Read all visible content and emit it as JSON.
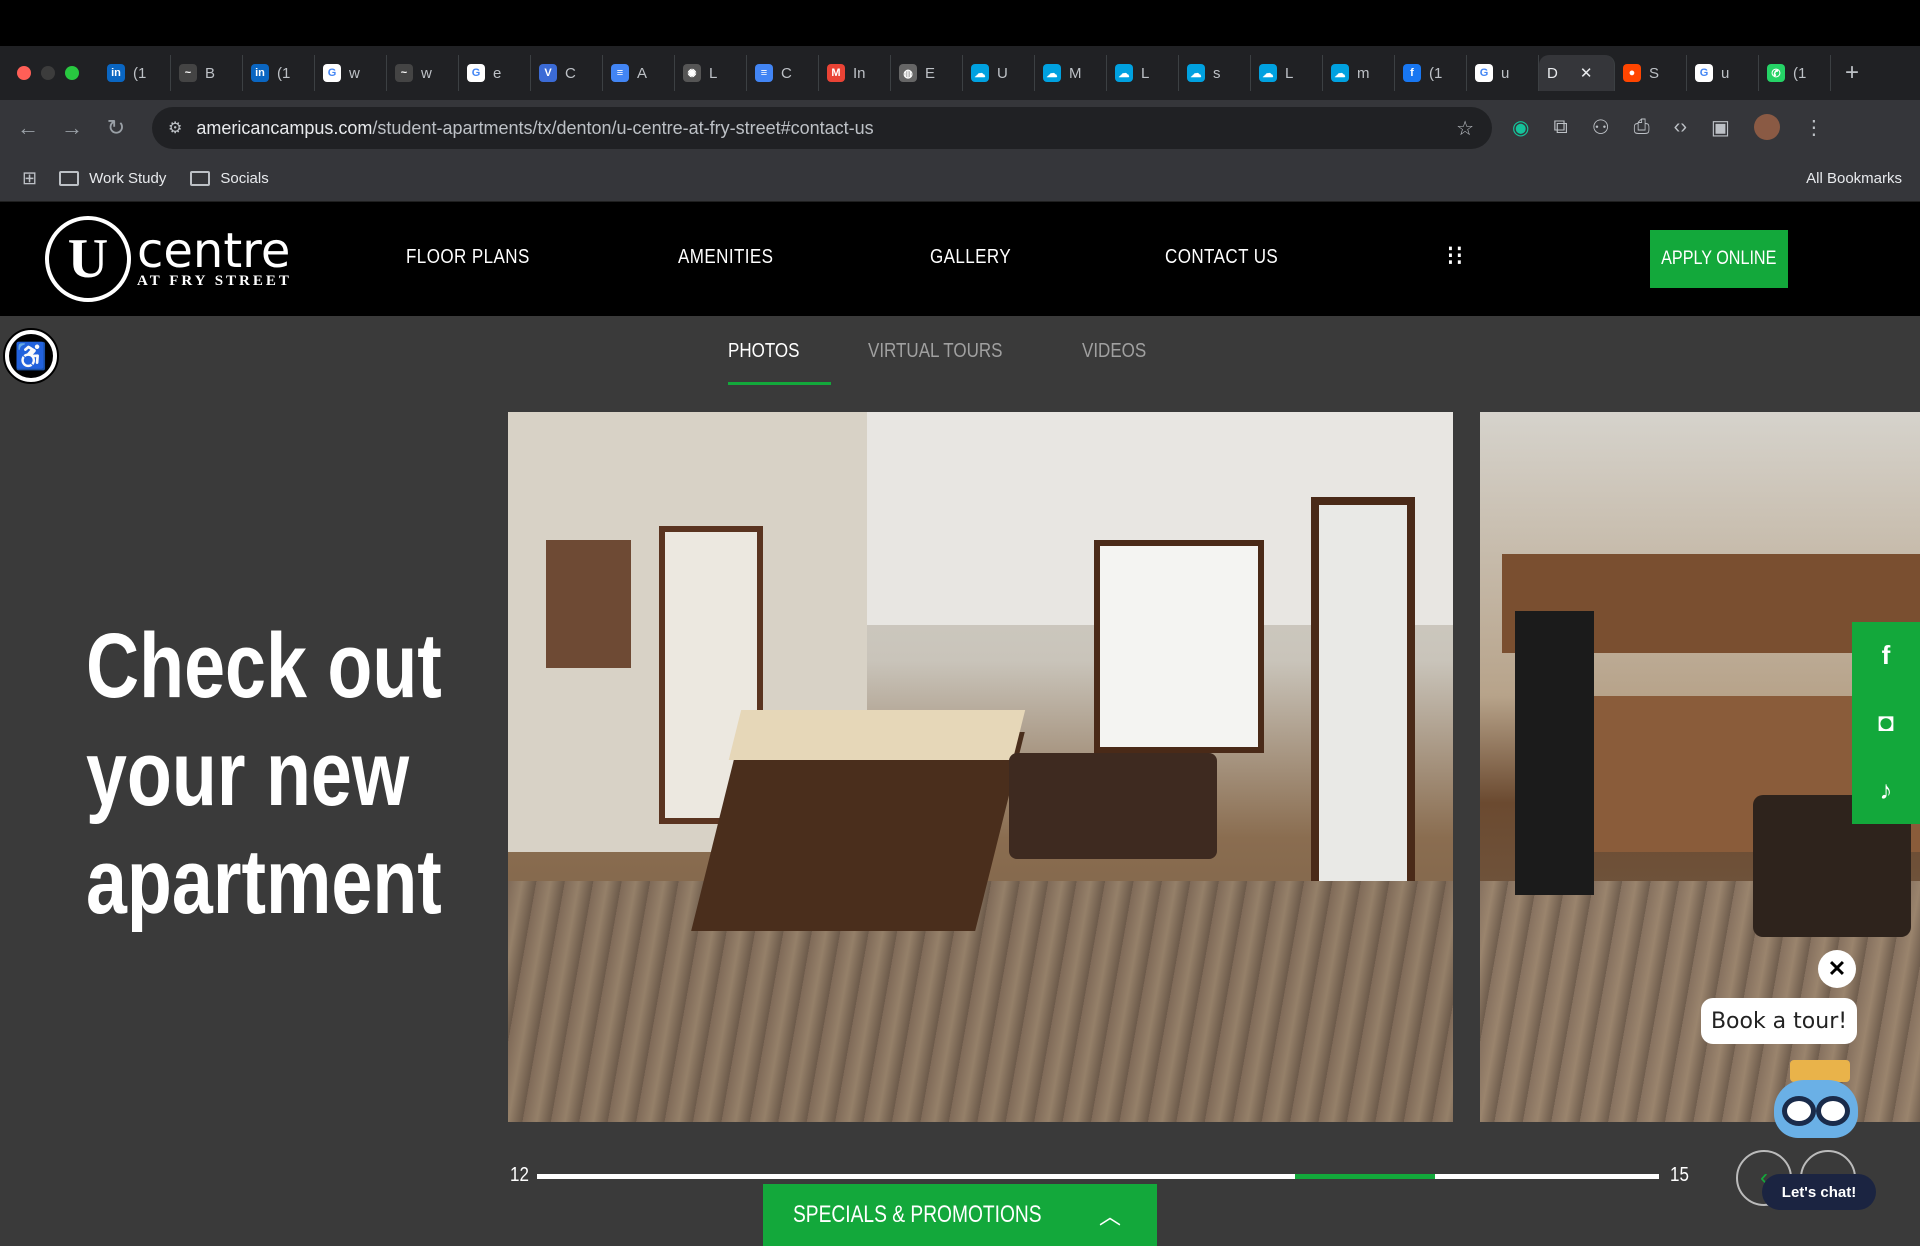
{
  "browser": {
    "tabs": [
      {
        "label": "(1",
        "icon": "linkedin-icon",
        "color": "#0a66c2",
        "glyph": "in"
      },
      {
        "label": "B",
        "icon": "blackboard-icon",
        "color": "#444",
        "glyph": "~"
      },
      {
        "label": "(1",
        "icon": "linkedin-icon",
        "color": "#0a66c2",
        "glyph": "in"
      },
      {
        "label": "w",
        "icon": "google-icon",
        "color": "#fff",
        "glyph": "G"
      },
      {
        "label": "w",
        "icon": "blackboard-icon",
        "color": "#444",
        "glyph": "~"
      },
      {
        "label": "e",
        "icon": "google-icon",
        "color": "#fff",
        "glyph": "G"
      },
      {
        "label": "C",
        "icon": "vercel-icon",
        "color": "#3b6bd6",
        "glyph": "V"
      },
      {
        "label": "A",
        "icon": "docs-icon",
        "color": "#4285f4",
        "glyph": "≡"
      },
      {
        "label": "L",
        "icon": "openai-icon",
        "color": "#555",
        "glyph": "✺"
      },
      {
        "label": "C",
        "icon": "docs-icon",
        "color": "#4285f4",
        "glyph": "≡"
      },
      {
        "label": "In",
        "icon": "gmail-icon",
        "color": "#ea4335",
        "glyph": "M"
      },
      {
        "label": "E",
        "icon": "globe-icon",
        "color": "#666",
        "glyph": "◍"
      },
      {
        "label": "U",
        "icon": "salesforce-icon",
        "color": "#00a1e0",
        "glyph": "☁"
      },
      {
        "label": "M",
        "icon": "salesforce-icon",
        "color": "#00a1e0",
        "glyph": "☁"
      },
      {
        "label": "L",
        "icon": "salesforce-icon",
        "color": "#00a1e0",
        "glyph": "☁"
      },
      {
        "label": "s",
        "icon": "salesforce-icon",
        "color": "#00a1e0",
        "glyph": "☁"
      },
      {
        "label": "L",
        "icon": "salesforce-icon",
        "color": "#00a1e0",
        "glyph": "☁"
      },
      {
        "label": "m",
        "icon": "salesforce-icon",
        "color": "#00a1e0",
        "glyph": "☁"
      },
      {
        "label": "(1",
        "icon": "facebook-icon",
        "color": "#1877f2",
        "glyph": "f"
      },
      {
        "label": "u",
        "icon": "google-icon",
        "color": "#fff",
        "glyph": "G"
      },
      {
        "label": "D",
        "icon": "",
        "color": "",
        "glyph": "",
        "active": true
      },
      {
        "label": "S",
        "icon": "reddit-icon",
        "color": "#ff4500",
        "glyph": "●"
      },
      {
        "label": "u",
        "icon": "google-icon",
        "color": "#fff",
        "glyph": "G"
      },
      {
        "label": "(1",
        "icon": "whatsapp-icon",
        "color": "#25d366",
        "glyph": "✆"
      }
    ],
    "url_host": "americancampus.com",
    "url_path": "/student-apartments/tx/denton/u-centre-at-fry-street#contact-us",
    "bookmarks": [
      "Work Study",
      "Socials"
    ],
    "all_bookmarks": "All Bookmarks"
  },
  "site": {
    "logo_mark": "U",
    "logo_word": "centre",
    "logo_sub": "AT FRY STREET",
    "nav": [
      "FLOOR PLANS",
      "AMENITIES",
      "GALLERY",
      "CONTACT US"
    ],
    "apply_label": "APPLY ONLINE",
    "gallery_tabs": [
      "PHOTOS",
      "VIRTUAL TOURS",
      "VIDEOS"
    ],
    "headline": [
      "Check out",
      "your new",
      "apartment"
    ],
    "counter_current": "12",
    "counter_total": "15",
    "progress_fraction": 0.8,
    "specials_label": "SPECIALS & PROMOTIONS",
    "book_tour": "Book a tour!",
    "lets_chat": "Let's chat!",
    "social_icons": [
      "facebook-icon",
      "instagram-icon",
      "tiktok-icon"
    ],
    "accent_color": "#13a83b"
  }
}
